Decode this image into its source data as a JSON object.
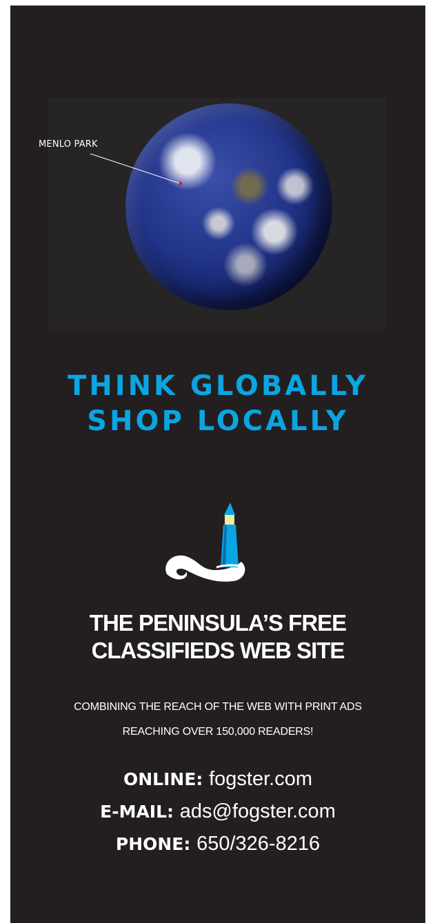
{
  "map": {
    "marker_label": "MENLO PARK",
    "marker_color": "#e0202a"
  },
  "headline": {
    "line1": "THINK GLOBALLY",
    "line2": "SHOP LOCALLY",
    "color": "#0aa5e3"
  },
  "logo": {
    "icon": "lighthouse-wave-icon"
  },
  "sub_headline": {
    "line1": "THE PENINSULA’S FREE",
    "line2": "CLASSIFIEDS WEB SITE"
  },
  "tagline": {
    "line1": "COMBINING THE REACH OF THE WEB WITH PRINT ADS",
    "line2": "REACHING OVER 150,000 READERS!"
  },
  "contact": {
    "online_label": "ONLINE:",
    "online_value": "fogster.com",
    "email_label": "E-MAIL:",
    "email_value": "ads@fogster.com",
    "phone_label": "PHONE:",
    "phone_value": "650/326-8216"
  },
  "colors": {
    "background": "#231f20",
    "accent": "#0aa5e3",
    "text": "#ffffff"
  }
}
